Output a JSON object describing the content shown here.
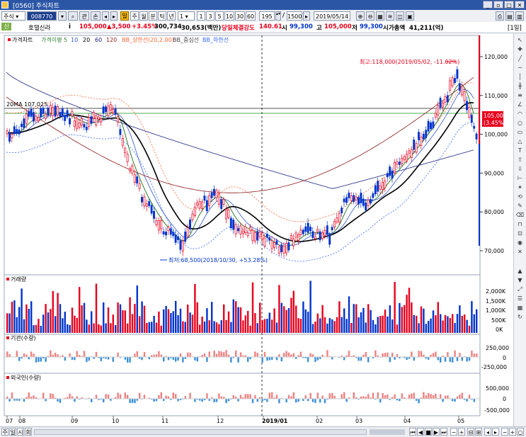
{
  "window": {
    "title": "[0560] 주식차트"
  },
  "toolbar": {
    "market": "주식",
    "code": "008770",
    "btn_gwan": "관",
    "btn_search": "손",
    "periods": [
      "주",
      "월",
      "분",
      "틱",
      "년"
    ],
    "unit_select": "1",
    "units": [
      "1",
      "3",
      "5",
      "10",
      "30",
      "60"
    ],
    "count": "195",
    "total": "1500",
    "date": "2019/05/14"
  },
  "quote": {
    "market_tag": "신",
    "name": "호텔신라",
    "info": "i",
    "price": "105,000",
    "change": "▲3,500",
    "change_pct": "+3.45%",
    "volume": "300,734",
    "amount": "30,653(백만)",
    "strength_label": "당일체결강도",
    "strength": "140.61",
    "open_label": "시",
    "open": "99,300",
    "high_label": "고",
    "high": "105,000",
    "low_label": "저",
    "low": "99,300",
    "cap_label": "시가총액",
    "cap": "41,211(억)",
    "period_tag": "[1일]"
  },
  "price_panel": {
    "legend": [
      "가격차트",
      "가격이평 5",
      "10",
      "20",
      "60",
      "120",
      "BB_상한선(20,2.00)",
      "BB_중심선",
      "BB_하한선"
    ],
    "ma20_label": "20MA 107,025",
    "high_note": "최고:118,000(2019/05/02, -11.02%)",
    "low_note": "최저:68,500(2018/10/30, +53.28%)",
    "current_box": [
      "105,000",
      "(3.45%)"
    ],
    "yticks": [
      "120,000",
      "110,000",
      "100,000",
      "90,000",
      "80,000",
      "70,000"
    ],
    "yvalues": [
      120000,
      110000,
      100000,
      90000,
      80000,
      70000
    ]
  },
  "volume_panel": {
    "title": "거래량",
    "yticks": [
      "2,000K",
      "1,500K",
      "1,000K",
      "500K",
      "0K"
    ]
  },
  "inst_panel": {
    "title": "기관(수량)",
    "yticks": [
      "250,000",
      "0",
      "-250,000"
    ]
  },
  "foreign_panel": {
    "title": "외국인(수량)",
    "yticks": [
      "500,000",
      "0",
      "-500,000"
    ]
  },
  "xaxis": {
    "labels": [
      "07",
      "08",
      "09",
      "10",
      "11",
      "12",
      "2019/01",
      "02",
      "03",
      "04",
      "05"
    ]
  },
  "bottom": {
    "tabs": [
      "주",
      "일",
      "시",
      "회"
    ]
  },
  "colors": {
    "up": "#e8001c",
    "down": "#0033cc",
    "ma5": "#2e7d32",
    "ma20": "#000000",
    "ma60": "#8b1a1a",
    "bb": "#ff6633"
  }
}
